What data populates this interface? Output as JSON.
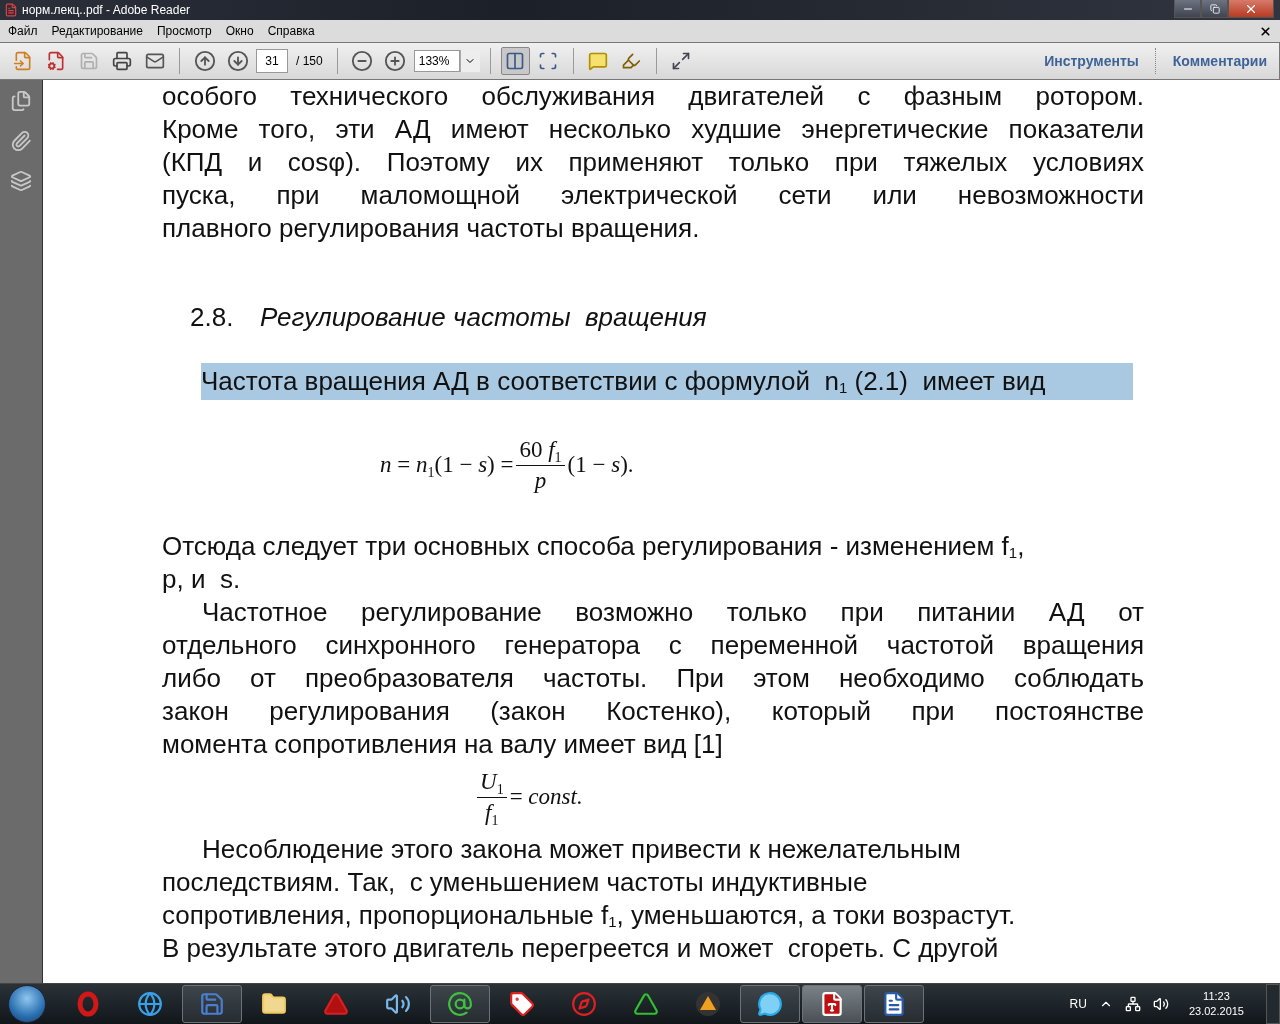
{
  "window": {
    "title": "норм.лекц..pdf - Adobe Reader"
  },
  "menu": [
    "Файл",
    "Редактирование",
    "Просмотр",
    "Окно",
    "Справка"
  ],
  "toolbar": {
    "save_disabled": true,
    "page_number": "31",
    "page_count": "/ 150",
    "zoom": "133%",
    "view_buttons": [
      {
        "selected": true
      },
      {
        "selected": false
      }
    ],
    "panels": [
      "Инструменты",
      "Комментарии"
    ]
  },
  "document": {
    "paragraph_1": {
      "kind": "justified",
      "indented": false,
      "lines": [
        "особого технического обслуживания двигателей с фазным ротором.",
        "Кроме того, эти АД имеют несколько худшие энергетические показатели",
        "(КПД и cosφ). Поэтому их применяют только при тяжелых условиях",
        "пуска, при маломощной электрической сети или невозможности",
        "плавного регулирования частоты вращения."
      ]
    },
    "heading": {
      "number": "2.8.",
      "title": "Регулирование частоты  вращения"
    },
    "highlighted_line": "Частота вращения АД в соответствии с формулой  n$_{1}$ (2.1)  имеет вид",
    "formula_1": {
      "left": "*n* = *n*$_{1}$(1 − *s*) =",
      "numerator": "60 *f*$_{1}$",
      "denominator": "*p*",
      "right": "(1 − *s*)."
    },
    "paragraphs": [
      {
        "kind": "ragged",
        "indented": false,
        "lines": [
          "Отсюда следует три основных способа регулирования - изменением f$_{1}$,",
          "p, и  s."
        ]
      },
      {
        "kind": "justified",
        "indented": true,
        "lines": [
          "Частотное регулирование возможно только при питании АД от",
          "отдельного синхронного генератора с переменной частотой вращения",
          "либо от преобразователя частоты. При этом необходимо соблюдать",
          "закон регулирования (закон Костенко), который при постоянстве",
          "момента сопротивления на валу имеет вид [1]"
        ]
      }
    ],
    "formula_2": {
      "numerator": "*U*$_{1}$",
      "denominator": "*f*$_{1}$",
      "right": "= *const.*"
    },
    "paragraph_last": {
      "kind": "ragged",
      "indented": true,
      "lines": [
        "Несоблюдение этого закона может привести к нежелательным",
        "последствиям. Так,  с уменьшением частоты индуктивные",
        "сопротивления, пропорциональные f$_{1}$, уменьшаются, а токи возрастут.",
        "В результате этого двигатель перегреется и может  сгореть. С другой"
      ]
    }
  },
  "taskbar": {
    "apps": [
      {
        "kind": "ring",
        "running": false,
        "selected": false
      },
      {
        "kind": "globe",
        "running": false,
        "selected": false
      },
      {
        "kind": "floppy",
        "running": true,
        "selected": false
      },
      {
        "kind": "folder",
        "running": false,
        "selected": false
      },
      {
        "kind": "cad",
        "running": false,
        "selected": false
      },
      {
        "kind": "speaker",
        "running": false,
        "selected": false
      },
      {
        "kind": "mail",
        "running": true,
        "selected": false
      },
      {
        "kind": "tag",
        "running": false,
        "selected": false
      },
      {
        "kind": "browser",
        "running": false,
        "selected": false
      },
      {
        "kind": "letter",
        "running": false,
        "selected": false
      },
      {
        "kind": "triangle",
        "running": false,
        "selected": false
      },
      {
        "kind": "chat",
        "running": true,
        "selected": false
      },
      {
        "kind": "pdf",
        "running": true,
        "selected": true
      },
      {
        "kind": "doc",
        "running": true,
        "selected": false
      }
    ],
    "language": "RU",
    "time": "11:23",
    "date": "23.02.2015"
  }
}
